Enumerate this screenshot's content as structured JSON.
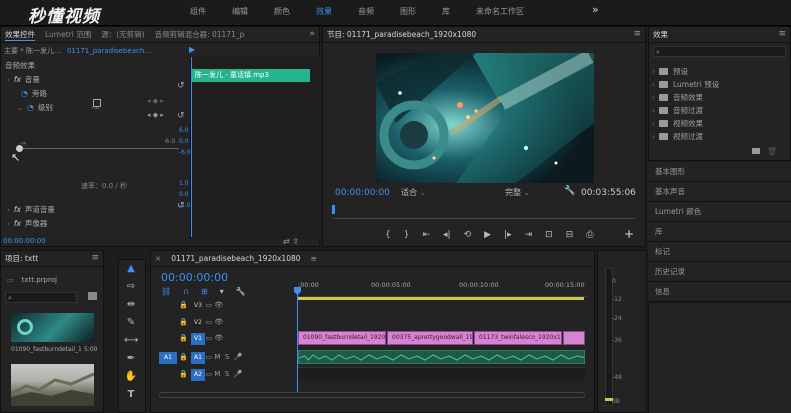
{
  "brand": {
    "logo_text": "秒懂视频"
  },
  "workspace_tabs": [
    "组件",
    "编辑",
    "颜色",
    "效果",
    "音频",
    "图形",
    "库",
    "未命名工作区"
  ],
  "workspace_selected": "效果",
  "effect_controls": {
    "tabs": [
      "效果控件",
      "Lumetri 范围",
      "源：(无剪辑)",
      "音频剪辑混合器: 01171_p"
    ],
    "clip_path": "主要 * 陈一发儿…",
    "sequence": "01171_paradisebeach…",
    "section_label": "音频效果",
    "volume": "音量",
    "bypass": "旁路",
    "level": "级别",
    "level_value": "-∞",
    "scale_max": "6.0",
    "scale_min": "-∞",
    "speed_label": "速率：0.0 / 秒",
    "channel_volume": "声道音量",
    "panner": "声像器",
    "timecode": "00:00:00:00",
    "clip_name": "陈一发儿 - 童话镇.mp3",
    "ruler_values": [
      "6.0",
      "0.0",
      "-6.0",
      "1.0",
      "0.0",
      "-1.0"
    ]
  },
  "program": {
    "title": "节目: 01171_paradisebeach_1920x1080",
    "timecode": "00:00:00:00",
    "fit": "适合",
    "quality": "完整",
    "duration": "00:03:55:06"
  },
  "effects_panel": {
    "title": "效果",
    "items": [
      "预设",
      "Lumetri 预设",
      "音频效果",
      "音频过渡",
      "视频效果",
      "视频过渡"
    ],
    "sections": [
      "基本图形",
      "基本声音",
      "Lumetri 颜色",
      "库",
      "标记",
      "历史记录",
      "信息"
    ]
  },
  "project": {
    "title": "项目: txtt",
    "file": "txtt.prproj",
    "clip1_name": "01090_fastburndetail_19…",
    "clip1_duration": "5:00"
  },
  "timeline": {
    "tab": "01171_paradisebeach_1920x1080",
    "timecode": "00:00:00:00",
    "ruler": [
      ":00:00",
      "00:00:05:00",
      "00:00:10:00",
      "00:00:15:00"
    ],
    "video_tracks": [
      "V3",
      "V2",
      "V1"
    ],
    "audio_tracks": [
      "A1",
      "A2"
    ],
    "clips": [
      "01090_fastburndetail_1920x",
      "00375_aprettygoodwall_1920",
      "01173_twinfalesco_1920x108",
      ""
    ]
  },
  "meter": {
    "labels": [
      "0",
      "-12",
      "-24",
      "-36",
      "-48",
      "dB"
    ]
  },
  "colors": {
    "accent": "#3f8ff2",
    "video_clip": "#d783d3",
    "audio_clip": "#1f5a49",
    "playhead": "#3f8ff2"
  }
}
